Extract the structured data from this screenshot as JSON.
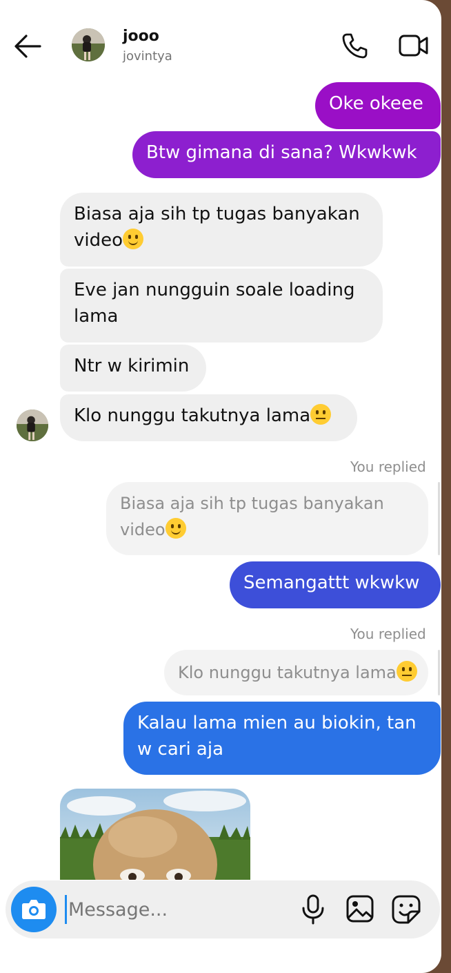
{
  "header": {
    "name": "jooo",
    "username": "jovintya"
  },
  "messages": {
    "m1": "Oke okeee",
    "m2": "Btw gimana di sana? Wkwkwk",
    "m3_line1": "Biasa aja sih tp tugas banyakan",
    "m3_line2": "video",
    "m4_line1": "Eve jan nungguin soale loading",
    "m4_line2": "lama",
    "m5": "Ntr w kirimin",
    "m6": "Klo nunggu takutnya lama",
    "reply1_label": "You replied",
    "reply1_quote_line1": "Biasa aja sih tp tugas banyakan",
    "reply1_quote_line2": "video",
    "m7": "Semangattt wkwkw",
    "reply2_label": "You replied",
    "reply2_quote": "Klo nunggu takutnya lama",
    "m8_line1": "Kalau lama mien au biokin, tan",
    "m8_line2": "w cari aja"
  },
  "composer": {
    "placeholder": "Message..."
  },
  "colors": {
    "out_purple": "#9a0fc6",
    "out_indigo": "#3d4fd9",
    "out_blue": "#2a72e6",
    "incoming": "#efefef",
    "accent": "#1e8cf0"
  },
  "icons": [
    "back-arrow-icon",
    "phone-icon",
    "video-camera-icon",
    "smiling-face-emoji",
    "neutral-face-emoji",
    "camera-icon",
    "microphone-icon",
    "gallery-icon",
    "sticker-icon"
  ]
}
